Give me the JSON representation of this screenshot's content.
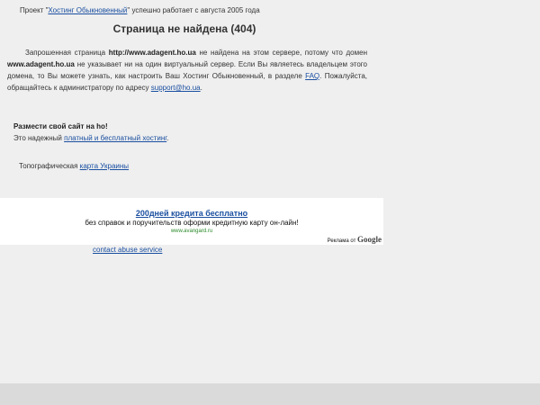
{
  "header": {
    "prefix": "Проект \"",
    "hosting_link": "Хостинг Обыкновенный",
    "suffix": "\" успешно работает с августа 2005 года"
  },
  "title": "Страница не найдена (404)",
  "message": {
    "part1": "Запрошенная страница ",
    "url": "http://www.adagent.ho.ua",
    "part2": " не найдена на этом сервере, потому что домен ",
    "domain": "www.adagent.ho.ua",
    "part3": " не указывает ни на один виртуальный сервер. Если Вы являетесь владельцем этого домена, то Вы можете узнать, как настроить Ваш Хостинг Обыкновенный, в разделе ",
    "faq_link": "FAQ",
    "part4": ". Пожалуйста, обращайтесь к администратору по адресу ",
    "email_link": "support@ho.ua",
    "part5": "."
  },
  "promo": {
    "heading": "Размести свой сайт на ho!",
    "text_prefix": "Это надежный ",
    "link": "платный и бесплатный хостинг",
    "text_suffix": "."
  },
  "topo": {
    "prefix": "Топографическая ",
    "link": "карта Украины"
  },
  "ad": {
    "title": "200дней кредита бесплатно",
    "text": "без справок и поручительств оформи кредитную карту он-лайн!",
    "url": "www.avangard.ru",
    "by_prefix": "Реклама от ",
    "by_brand": "Google"
  },
  "abuse_link": "contact abuse service"
}
